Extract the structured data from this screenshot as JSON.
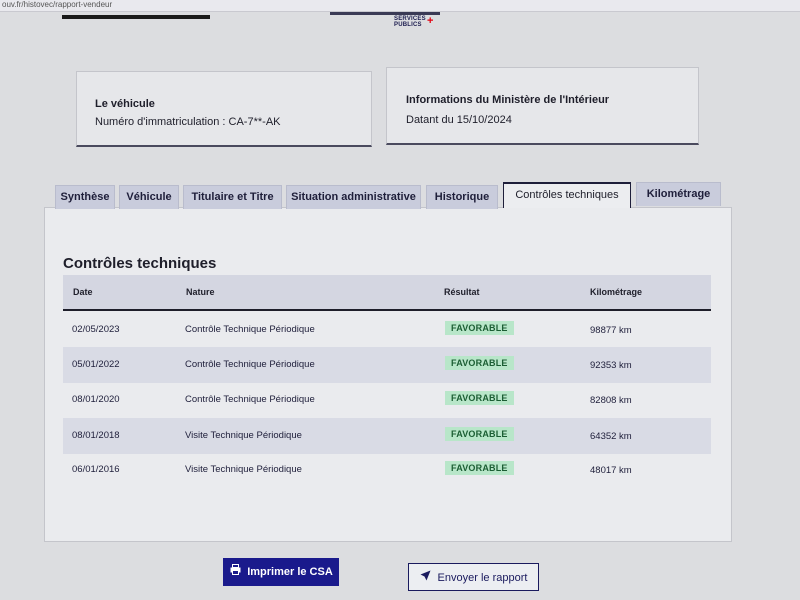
{
  "browser": {
    "url": "ouv.fr/histovec/rapport-vendeur"
  },
  "header": {
    "logo_text": "SERVICES PUBLICS",
    "logo_plus": "+"
  },
  "vehicle_card": {
    "title": "Le véhicule",
    "plate_line": "Numéro d'immatriculation : CA-7**-AK"
  },
  "ministry_card": {
    "title": "Informations du Ministère de l'Intérieur",
    "date_line": "Datant du 15/10/2024"
  },
  "tabs": [
    {
      "label": "Synthèse",
      "active": false
    },
    {
      "label": "Véhicule",
      "active": false
    },
    {
      "label": "Titulaire et Titre",
      "active": false
    },
    {
      "label": "Situation administrative",
      "active": false
    },
    {
      "label": "Historique",
      "active": false
    },
    {
      "label": "Contrôles techniques",
      "active": true
    },
    {
      "label": "Kilométrage",
      "active": false
    }
  ],
  "section": {
    "title": "Contrôles techniques",
    "columns": [
      "Date",
      "Nature",
      "Résultat",
      "Kilométrage"
    ],
    "rows": [
      {
        "date": "02/05/2023",
        "nature": "Contrôle Technique Périodique",
        "result": "FAVORABLE",
        "km": "98877 km"
      },
      {
        "date": "05/01/2022",
        "nature": "Contrôle Technique Périodique",
        "result": "FAVORABLE",
        "km": "92353 km"
      },
      {
        "date": "08/01/2020",
        "nature": "Contrôle Technique Périodique",
        "result": "FAVORABLE",
        "km": "82808 km"
      },
      {
        "date": "08/01/2018",
        "nature": "Visite Technique Périodique",
        "result": "FAVORABLE",
        "km": "64352 km"
      },
      {
        "date": "06/01/2016",
        "nature": "Visite Technique Périodique",
        "result": "FAVORABLE",
        "km": "48017 km"
      }
    ]
  },
  "actions": {
    "print_label": "Imprimer le CSA",
    "print_icon": "printer-icon",
    "send_label": "Envoyer le rapport",
    "send_icon": "send-icon"
  },
  "colors": {
    "primary": "#1a1a8c",
    "badge_bg": "#b8e6c9",
    "badge_text": "#1b5e33",
    "tab_bg": "#c9ccdc"
  }
}
